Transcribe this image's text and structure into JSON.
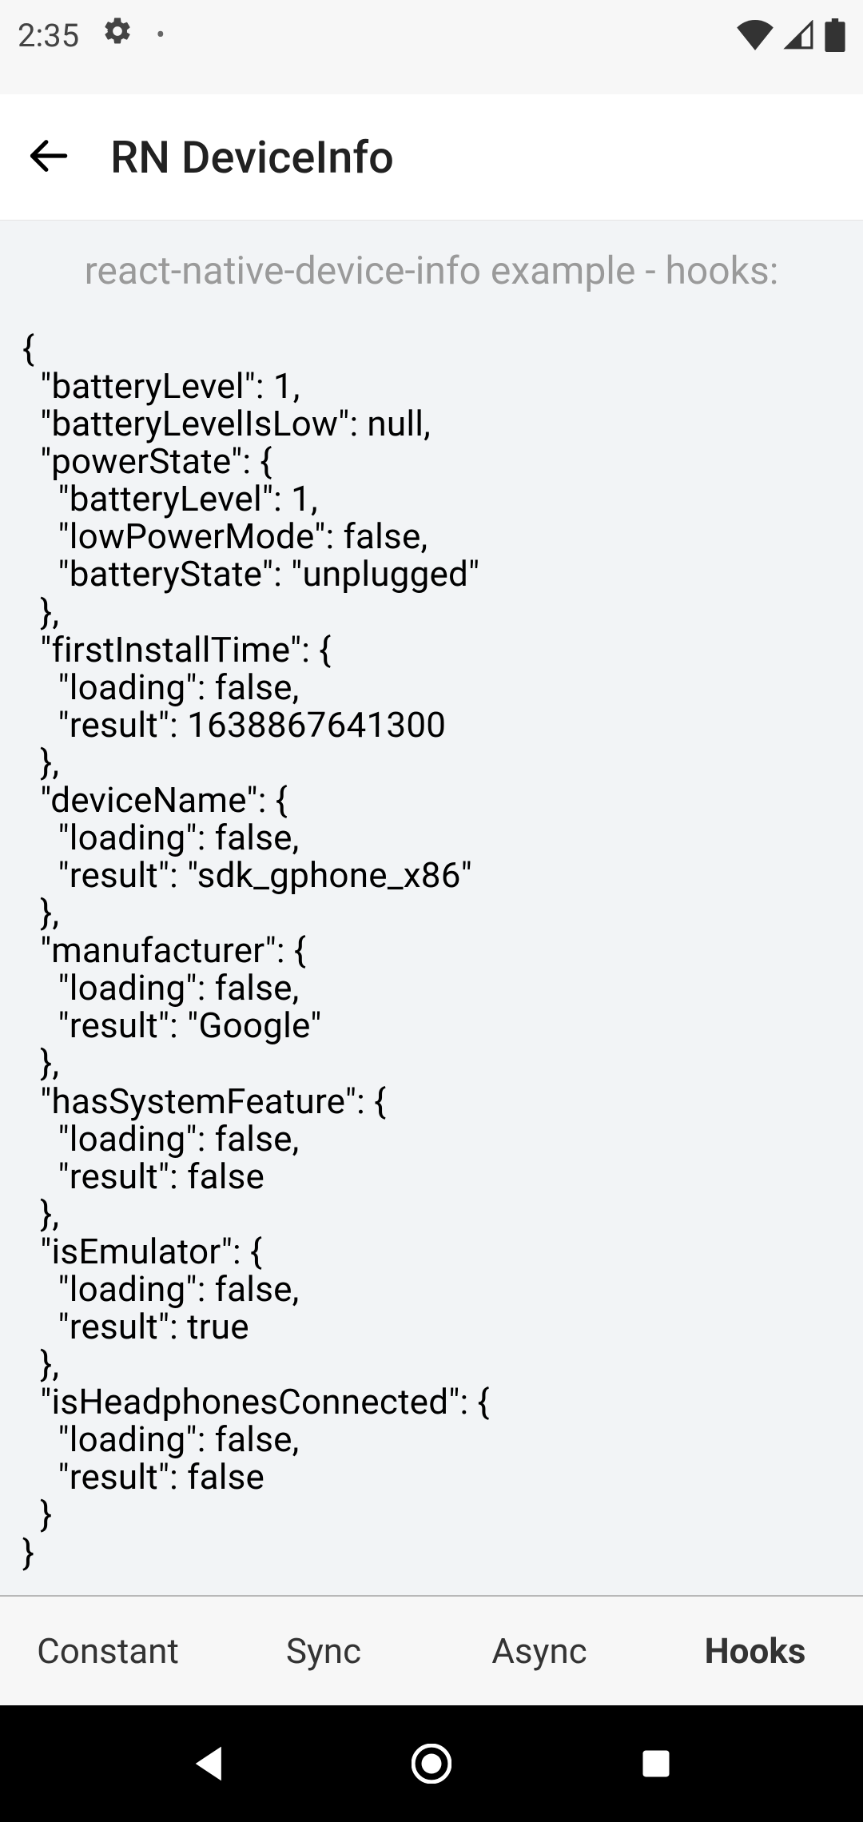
{
  "status_bar": {
    "time": "2:35"
  },
  "header": {
    "title": "RN DeviceInfo"
  },
  "content": {
    "heading": "react-native-device-info example - hooks:"
  },
  "device_info": {
    "batteryLevel": 1,
    "batteryLevelIsLow": null,
    "powerState": {
      "batteryLevel": 1,
      "lowPowerMode": false,
      "batteryState": "unplugged"
    },
    "firstInstallTime": {
      "loading": false,
      "result": 1638867641300
    },
    "deviceName": {
      "loading": false,
      "result": "sdk_gphone_x86"
    },
    "manufacturer": {
      "loading": false,
      "result": "Google"
    },
    "hasSystemFeature": {
      "loading": false,
      "result": false
    },
    "isEmulator": {
      "loading": false,
      "result": true
    },
    "isHeadphonesConnected": {
      "loading": false,
      "result": false
    }
  },
  "tabs": [
    {
      "label": "Constant",
      "active": false
    },
    {
      "label": "Sync",
      "active": false
    },
    {
      "label": "Async",
      "active": false
    },
    {
      "label": "Hooks",
      "active": true
    }
  ]
}
